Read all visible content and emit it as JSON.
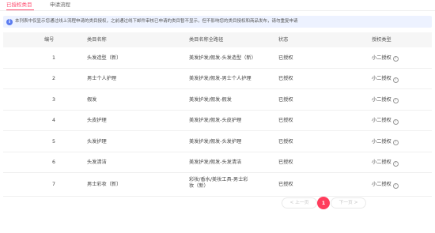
{
  "tabs": {
    "active": "已授权类目",
    "inactive": "申请流程"
  },
  "notice": {
    "text": "本列表中仅显示您通过线上流程申请的类目授权，之前通过线下邮件审核已申请的类目暂不显示，但不影响您的类目授权和商品发布，请勿重复申请"
  },
  "table": {
    "headers": [
      "编号",
      "类目名称",
      "类目名称全路径",
      "状态",
      "授权类型"
    ],
    "rows": [
      {
        "num": "1",
        "name": "头发造型（新）",
        "path": "美发护发/假发-头发造型（新）",
        "status": "已授权",
        "type": "小二授权"
      },
      {
        "num": "2",
        "name": "男士个人护理",
        "path": "美发护发/假发-男士个人护理",
        "status": "已授权",
        "type": "小二授权"
      },
      {
        "num": "3",
        "name": "假发",
        "path": "美发护发/假发-假发",
        "status": "已授权",
        "type": "小二授权"
      },
      {
        "num": "4",
        "name": "头皮护理",
        "path": "美发护发/假发-头皮护理",
        "status": "已授权",
        "type": "小二授权"
      },
      {
        "num": "5",
        "name": "头发护理",
        "path": "美发护发/假发-头发护理",
        "status": "已授权",
        "type": "小二授权"
      },
      {
        "num": "6",
        "name": "头发清洁",
        "path": "美发护发/假发-头发清洁",
        "status": "已授权",
        "type": "小二授权"
      },
      {
        "num": "7",
        "name": "男士彩妆（新）",
        "path": "彩妆/香水/美妆工具-男士彩妆（新）",
        "status": "已授权",
        "type": "小二授权"
      }
    ]
  },
  "pagination": {
    "prev": "< 上一页",
    "current": "1",
    "next": "下一页 >"
  },
  "colors": {
    "accent": "#ff3d5c",
    "notice_bg": "#edf2ff",
    "info_icon": "#5b7cf0"
  },
  "icons": {
    "notice": "info-icon",
    "type_help": "question-circle-icon"
  }
}
